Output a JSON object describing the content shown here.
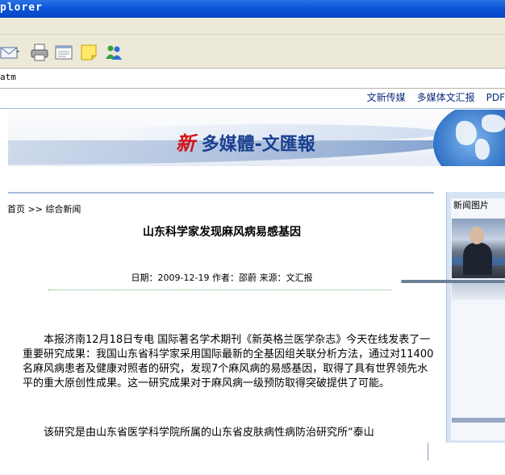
{
  "window": {
    "title_fragment": "plorer"
  },
  "address_bar": {
    "value": "atm"
  },
  "toolbar": {
    "icons": [
      "mail-icon",
      "print-icon",
      "edit-icon",
      "note-icon",
      "messenger-icon"
    ]
  },
  "site": {
    "top_nav": [
      "文新传媒",
      "多媒体文汇报",
      "PDF"
    ],
    "logo": {
      "prefix": "新",
      "name": "多媒體-文匯報"
    }
  },
  "article": {
    "breadcrumb": "首页  >> 综合新闻",
    "title": "山东科学家发现麻风病易感基因",
    "meta": "日期：2009-12-19 作者：邵蔚  来源：文汇报",
    "paragraphs": [
      "本报济南12月18日专电  国际著名学术期刊《新英格兰医学杂志》今天在线发表了一重要研究成果：我国山东省科学家采用国际最新的全基因组关联分析方法，通过对11400名麻风病患者及健康对照者的研究，发现7个麻风病的易感基因，取得了具有世界领先水平的重大原创性成果。这一研究成果对于麻风病一级预防取得突破提供了可能。",
      "该研究是由山东省医学科学院所属的山东省皮肤病性病防治研究所“泰山"
    ]
  },
  "sidebar": {
    "title": "新闻图片"
  }
}
